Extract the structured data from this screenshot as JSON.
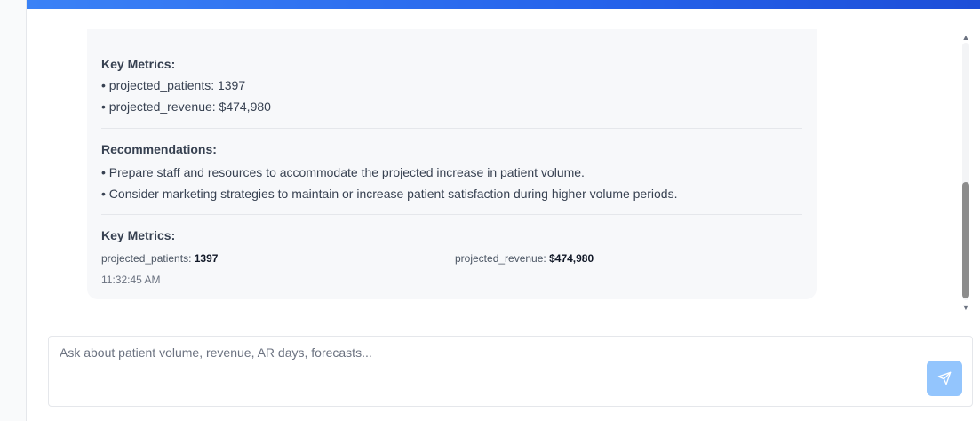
{
  "message": {
    "key_metrics_heading": "Key Metrics:",
    "key_metrics_bullets": [
      "• projected_patients: 1397",
      "• projected_revenue: $474,980"
    ],
    "recommendations_heading": "Recommendations:",
    "recommendations": [
      "• Prepare staff and resources to accommodate the projected increase in patient volume.",
      "• Consider marketing strategies to maintain or increase patient satisfaction during higher volume periods."
    ],
    "metrics_grid_heading": "Key Metrics:",
    "metrics_grid": [
      {
        "label": "projected_patients:",
        "value": "1397"
      },
      {
        "label": "projected_revenue:",
        "value": "$474,980"
      }
    ],
    "timestamp": "11:32:45 AM"
  },
  "input": {
    "placeholder": "Ask about patient volume, revenue, AR days, forecasts..."
  },
  "icons": {
    "send": "send-icon",
    "scroll_up": "chevron-up-icon",
    "scroll_down": "chevron-down-icon"
  },
  "colors": {
    "accent": "#2563eb",
    "send_button": "#93c5fd",
    "card_background": "#f7f8fa"
  }
}
